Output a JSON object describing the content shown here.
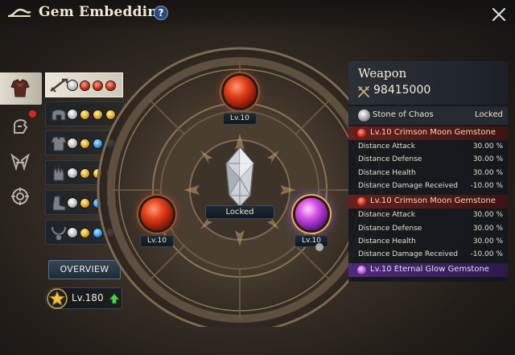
{
  "header": {
    "title": "Gem Embedding",
    "help_label": "?"
  },
  "wheel": {
    "center_status": "Locked",
    "slots": [
      {
        "position": "top",
        "level": "Lv.10",
        "gem_color": "red"
      },
      {
        "position": "left",
        "level": "Lv.10",
        "gem_color": "red"
      },
      {
        "position": "right",
        "level": "Lv.10",
        "gem_color": "violet"
      }
    ]
  },
  "side_tabs": [
    {
      "name": "armor",
      "active": true
    },
    {
      "name": "gear",
      "badge": true
    },
    {
      "name": "wings"
    },
    {
      "name": "target"
    }
  ],
  "equipment": [
    {
      "name": "weapon",
      "selected": true,
      "gems": [
        "white",
        "red",
        "red",
        "red"
      ]
    },
    {
      "name": "helmet",
      "gems": [
        "white",
        "gold",
        "gold",
        "gold"
      ]
    },
    {
      "name": "chest",
      "gems": [
        "white",
        "gold",
        "blue",
        "blue"
      ]
    },
    {
      "name": "gloves",
      "gems": [
        "white",
        "gold",
        "gold",
        "gold"
      ]
    },
    {
      "name": "boots",
      "gems": [
        "white",
        "gold",
        "blue",
        "purple"
      ]
    },
    {
      "name": "necklace",
      "gems": [
        "white",
        "gold",
        "blue",
        "purple"
      ]
    }
  ],
  "overview_label": "OVERVIEW",
  "player_level": "Lv.180",
  "panel": {
    "title": "Weapon",
    "power": "98415000",
    "stone_name": "Stone of Chaos",
    "stone_status": "Locked",
    "gems": [
      {
        "name": "Lv.10 Crimson Moon Gemstone",
        "color": "red",
        "stats": [
          {
            "label": "Distance Attack",
            "value": "30.00 %"
          },
          {
            "label": "Distance Defense",
            "value": "30.00 %"
          },
          {
            "label": "Distance Health",
            "value": "30.00 %"
          },
          {
            "label": "Distance Damage Received",
            "value": "-10.00 %"
          }
        ]
      },
      {
        "name": "Lv.10 Crimson Moon Gemstone",
        "color": "red",
        "stats": [
          {
            "label": "Distance Attack",
            "value": "30.00 %"
          },
          {
            "label": "Distance Defense",
            "value": "30.00 %"
          },
          {
            "label": "Distance Health",
            "value": "30.00 %"
          },
          {
            "label": "Distance Damage Received",
            "value": "-10.00 %"
          }
        ]
      },
      {
        "name": "Lv.10 Eternal Glow Gemstone",
        "color": "purple",
        "stats": []
      }
    ]
  },
  "colors": {
    "accent_red": "#6a1f1f",
    "accent_purple": "#4e2b7a",
    "button_blue": "#364656",
    "level_up_green": "#4fd14a"
  }
}
